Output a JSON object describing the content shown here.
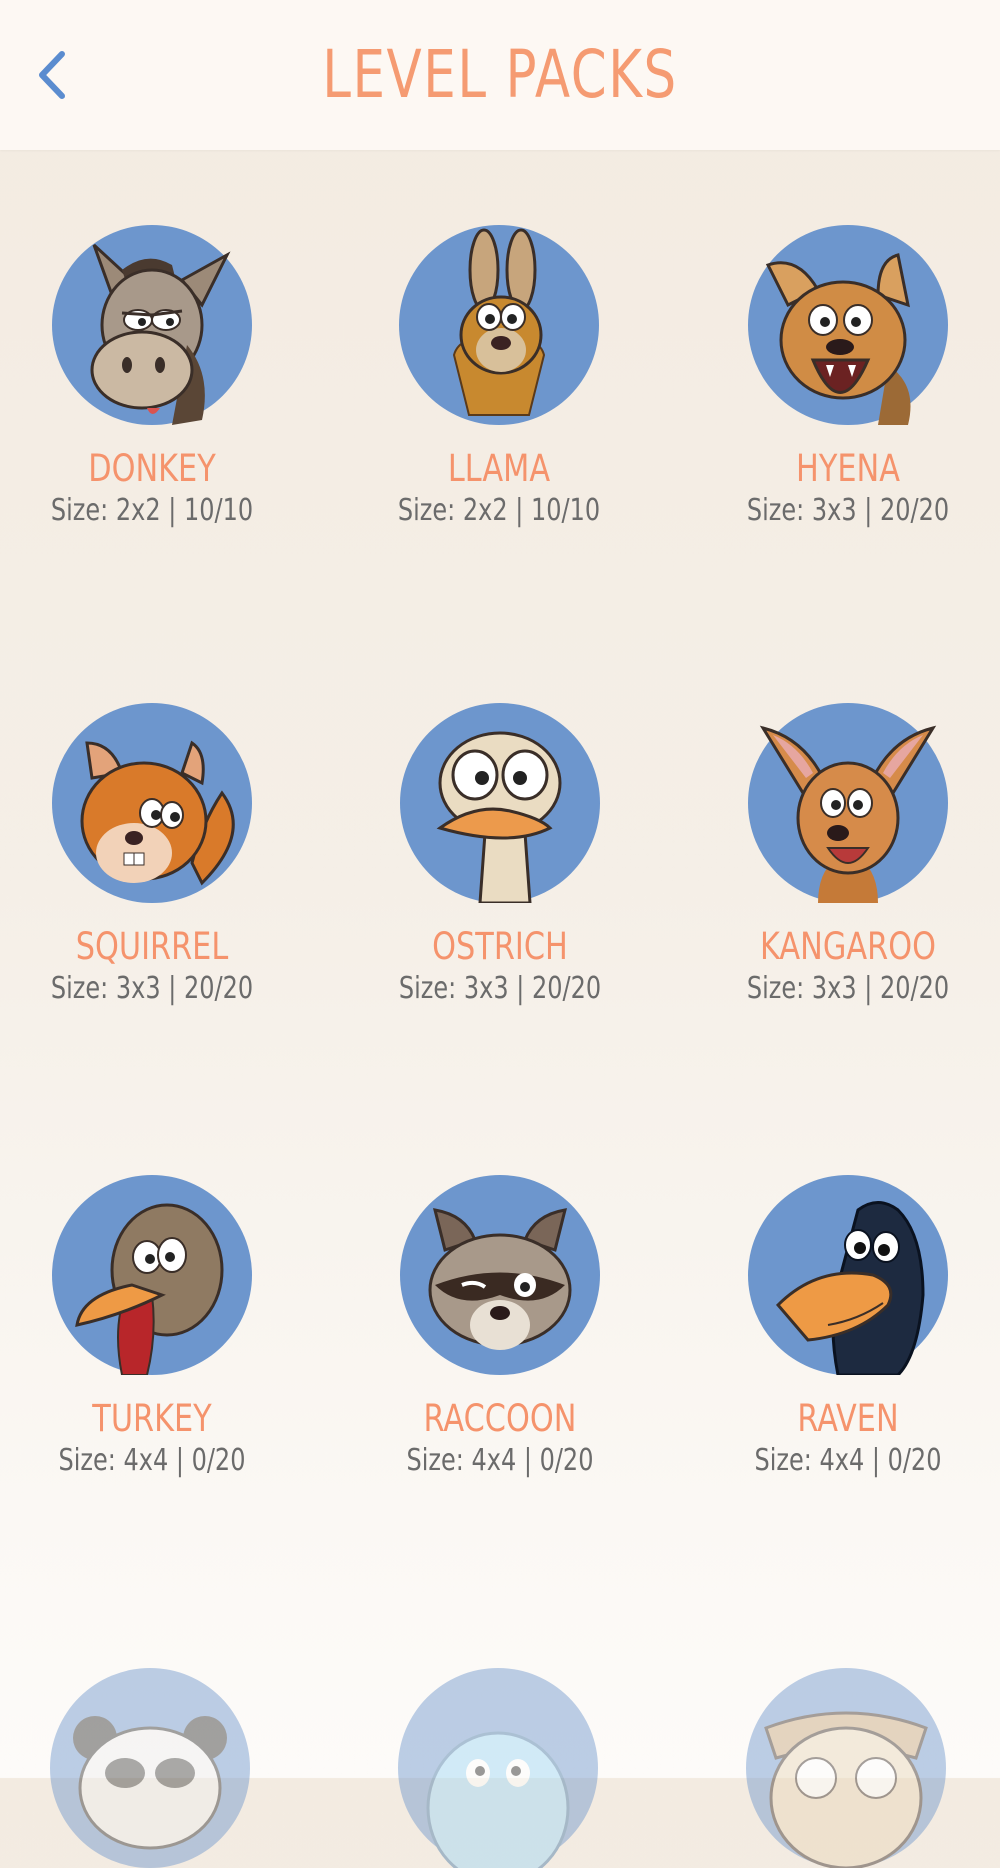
{
  "header": {
    "title": "LEVEL PACKS",
    "back_icon": "chevron-left-icon"
  },
  "packs": [
    {
      "name": "DONKEY",
      "info": "Size: 2x2  |  10/10"
    },
    {
      "name": "LLAMA",
      "info": "Size: 2x2  |  10/10"
    },
    {
      "name": "HYENA",
      "info": "Size: 3x3  |  20/20"
    },
    {
      "name": "SQUIRREL",
      "info": "Size: 3x3  |  20/20"
    },
    {
      "name": "OSTRICH",
      "info": "Size: 3x3  |  20/20"
    },
    {
      "name": "KANGAROO",
      "info": "Size: 3x3  |  20/20"
    },
    {
      "name": "TURKEY",
      "info": "Size: 4x4  |  0/20"
    },
    {
      "name": "RACCOON",
      "info": "Size: 4x4  |  0/20"
    },
    {
      "name": "RAVEN",
      "info": "Size: 4x4  |  0/20"
    }
  ],
  "colors": {
    "accent": "#f5936c",
    "back": "#5b8ccf",
    "avatar_bg": "#6d96cd",
    "info_text": "#6b6b6b"
  }
}
